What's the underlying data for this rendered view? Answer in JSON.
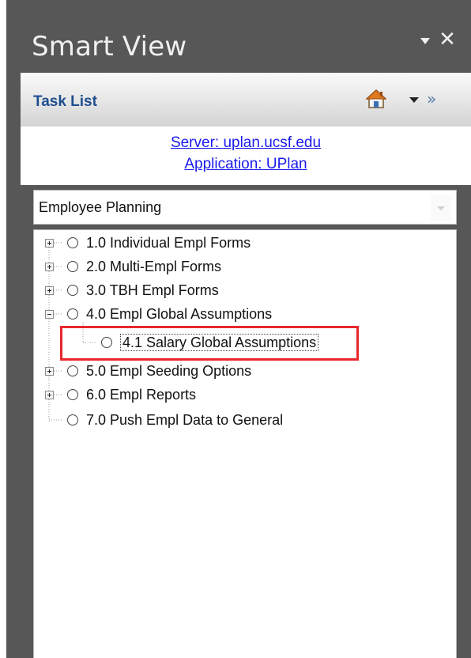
{
  "panel": {
    "title": "Smart View"
  },
  "task_bar": {
    "label": "Task List"
  },
  "connection": {
    "server": "Server: uplan.ucsf.edu",
    "application": "Application: UPlan"
  },
  "task_list_select": {
    "value": "Employee Planning"
  },
  "tree": {
    "items": [
      {
        "label": "1.0 Individual Empl Forms",
        "expander": "plus"
      },
      {
        "label": "2.0 Multi-Empl Forms",
        "expander": "plus"
      },
      {
        "label": "3.0 TBH Empl Forms",
        "expander": "plus"
      },
      {
        "label": "4.0 Empl Global Assumptions",
        "expander": "minus"
      },
      {
        "label": "4.1 Salary Global Assumptions",
        "expander": "none",
        "selected": true
      },
      {
        "label": "5.0 Empl Seeding Options",
        "expander": "plus"
      },
      {
        "label": "6.0 Empl Reports",
        "expander": "plus"
      },
      {
        "label": "7.0 Push Empl Data to General",
        "expander": "none"
      }
    ]
  },
  "colors": {
    "pane_background": "#575757",
    "link": "#1a1aee",
    "task_label": "#1f4e8f",
    "highlight_box": "#e8282e"
  },
  "icons": [
    "chevron-down-icon",
    "close-icon",
    "home-icon",
    "chevron-down-icon",
    "double-chevron-right-icon",
    "radio-icon",
    "plus-box-icon",
    "minus-box-icon"
  ]
}
